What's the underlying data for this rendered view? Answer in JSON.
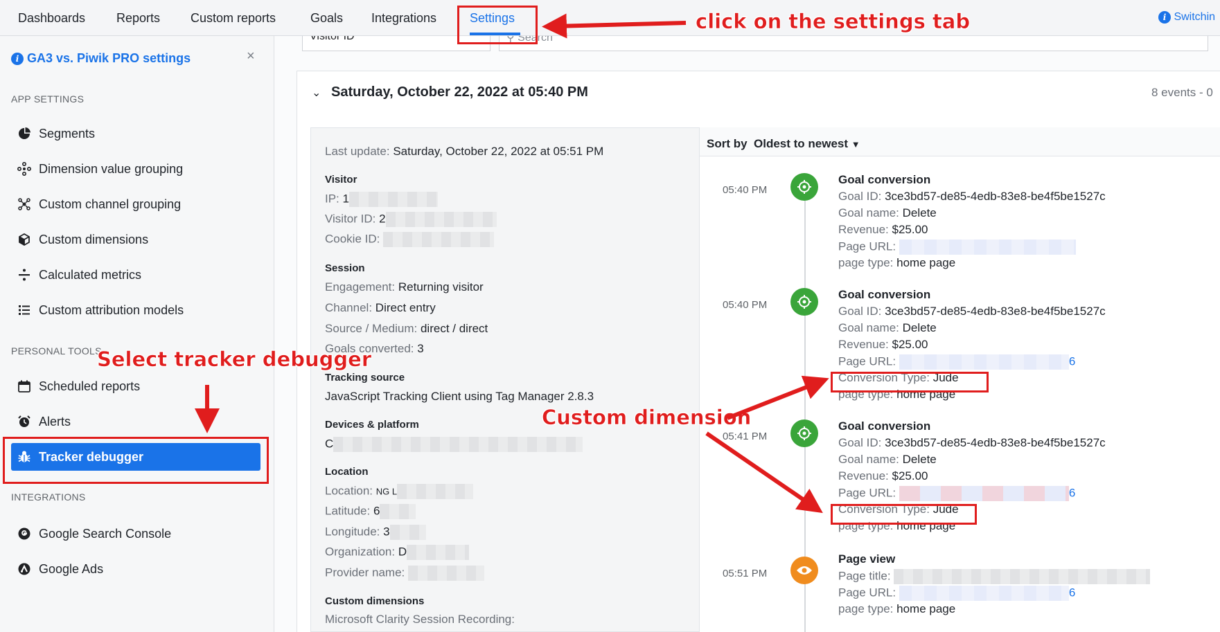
{
  "topnav": {
    "tabs": [
      "Dashboards",
      "Reports",
      "Custom reports",
      "Goals",
      "Integrations",
      "Settings"
    ],
    "right_text": "Switchin"
  },
  "sidebar": {
    "header": "GA3 vs. Piwik PRO settings",
    "close": "×",
    "sections": {
      "app": "APP SETTINGS",
      "personal": "PERSONAL TOOLS",
      "integrations": "INTEGRATIONS"
    },
    "app_items": [
      "Segments",
      "Dimension value grouping",
      "Custom channel grouping",
      "Custom dimensions",
      "Calculated metrics",
      "Custom attribution models"
    ],
    "personal_items": [
      "Scheduled reports",
      "Alerts",
      "Tracker debugger"
    ],
    "integration_items": [
      "Google Search Console",
      "Google Ads"
    ]
  },
  "filters": {
    "visitor_id": "Visitor ID",
    "search_placeholder": "Search"
  },
  "session": {
    "date": "Saturday, October 22, 2022 at 05:40 PM",
    "events_count": "8 events - 0"
  },
  "details": {
    "last_update_label": "Last update:",
    "last_update_value": "Saturday, October 22, 2022 at 05:51 PM",
    "visitor_head": "Visitor",
    "ip_label": "IP:",
    "ip_value": "1",
    "visitor_id_label": "Visitor ID:",
    "visitor_id_value": "2",
    "cookie_id_label": "Cookie ID:",
    "session_head": "Session",
    "engagement_label": "Engagement:",
    "engagement_value": "Returning visitor",
    "channel_label": "Channel:",
    "channel_value": "Direct entry",
    "source_label": "Source / Medium:",
    "source_value": "direct / direct",
    "goals_label": "Goals converted:",
    "goals_value": "3",
    "tracking_head": "Tracking source",
    "tracking_value": "JavaScript Tracking Client using Tag Manager 2.8.3",
    "devices_head": "Devices & platform",
    "devices_value": "C",
    "location_head": "Location",
    "location_label": "Location:",
    "location_value": "NG L",
    "latitude_label": "Latitude:",
    "latitude_value": "6",
    "longitude_label": "Longitude:",
    "longitude_value": "3",
    "org_label": "Organization:",
    "org_value": "D",
    "provider_label": "Provider name:",
    "custom_dims_head": "Custom dimensions",
    "custom_dims_value": "Microsoft Clarity Session Recording:"
  },
  "sort": {
    "label": "Sort by",
    "value": "Oldest to newest"
  },
  "events": [
    {
      "time": "05:40 PM",
      "title": "Goal conversion",
      "goal_id_label": "Goal ID:",
      "goal_id": "3ce3bd57-de85-4edb-83e8-be4f5be1527c",
      "goal_name_label": "Goal name:",
      "goal_name": "Delete",
      "revenue_label": "Revenue:",
      "revenue": "$25.00",
      "page_url_label": "Page URL:",
      "page_type_label": "page type:",
      "page_type": "home page"
    },
    {
      "time": "05:40 PM",
      "title": "Goal conversion",
      "goal_id_label": "Goal ID:",
      "goal_id": "3ce3bd57-de85-4edb-83e8-be4f5be1527c",
      "goal_name_label": "Goal name:",
      "goal_name": "Delete",
      "revenue_label": "Revenue:",
      "revenue": "$25.00",
      "page_url_label": "Page URL:",
      "page_url_tail": "6",
      "conversion_label": "Conversion Type:",
      "conversion_value": "Jude",
      "page_type_label": "page type:",
      "page_type": "home page"
    },
    {
      "time": "05:41 PM",
      "title": "Goal conversion",
      "goal_id_label": "Goal ID:",
      "goal_id": "3ce3bd57-de85-4edb-83e8-be4f5be1527c",
      "goal_name_label": "Goal name:",
      "goal_name": "Delete",
      "revenue_label": "Revenue:",
      "revenue": "$25.00",
      "page_url_label": "Page URL:",
      "page_url_tail": "6",
      "conversion_label": "Conversion Type:",
      "conversion_value": "Jude",
      "page_type_label": "page type:",
      "page_type": "home page"
    },
    {
      "time": "05:51 PM",
      "title": "Page view",
      "page_title_label": "Page title:",
      "page_url_label": "Page URL:",
      "page_url_tail": "6",
      "page_type_label": "page type:",
      "page_type": "home page"
    }
  ],
  "annotations": {
    "settings": "click on the settings tab",
    "tracker": "Select tracker debugger",
    "custom_dim": "Custom dimension",
    "color": "#e01d1d"
  }
}
